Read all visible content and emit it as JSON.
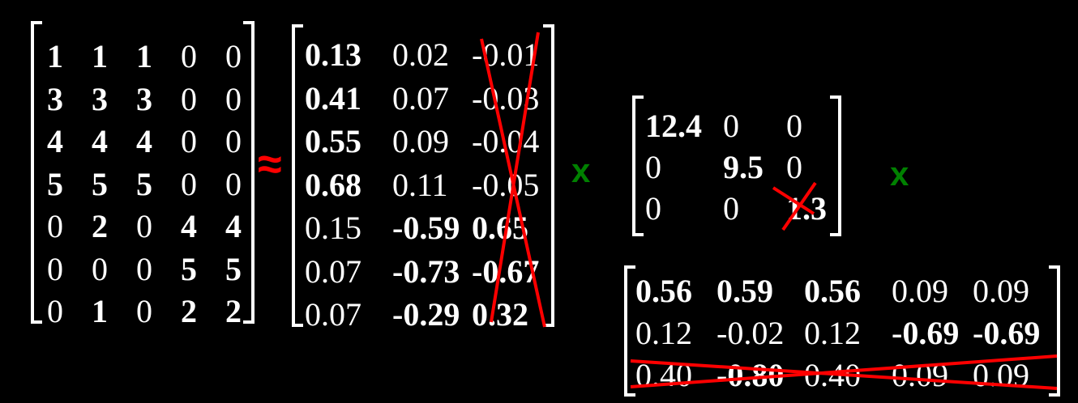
{
  "colors": {
    "background": "#000000",
    "text": "#ffffff",
    "approx": "#ff0000",
    "times": "#008000",
    "strike": "#ff0000"
  },
  "operators": {
    "approx": "≈",
    "times1": "x",
    "times2": "x"
  },
  "matrices": {
    "A": {
      "rows": [
        [
          {
            "v": "1",
            "b": true
          },
          {
            "v": "1",
            "b": true
          },
          {
            "v": "1",
            "b": true
          },
          {
            "v": "0",
            "b": false
          },
          {
            "v": "0",
            "b": false
          }
        ],
        [
          {
            "v": "3",
            "b": true
          },
          {
            "v": "3",
            "b": true
          },
          {
            "v": "3",
            "b": true
          },
          {
            "v": "0",
            "b": false
          },
          {
            "v": "0",
            "b": false
          }
        ],
        [
          {
            "v": "4",
            "b": true
          },
          {
            "v": "4",
            "b": true
          },
          {
            "v": "4",
            "b": true
          },
          {
            "v": "0",
            "b": false
          },
          {
            "v": "0",
            "b": false
          }
        ],
        [
          {
            "v": "5",
            "b": true
          },
          {
            "v": "5",
            "b": true
          },
          {
            "v": "5",
            "b": true
          },
          {
            "v": "0",
            "b": false
          },
          {
            "v": "0",
            "b": false
          }
        ],
        [
          {
            "v": "0",
            "b": false
          },
          {
            "v": "2",
            "b": true
          },
          {
            "v": "0",
            "b": false
          },
          {
            "v": "4",
            "b": true
          },
          {
            "v": "4",
            "b": true
          }
        ],
        [
          {
            "v": "0",
            "b": false
          },
          {
            "v": "0",
            "b": false
          },
          {
            "v": "0",
            "b": false
          },
          {
            "v": "5",
            "b": true
          },
          {
            "v": "5",
            "b": true
          }
        ],
        [
          {
            "v": "0",
            "b": false
          },
          {
            "v": "1",
            "b": true
          },
          {
            "v": "0",
            "b": false
          },
          {
            "v": "2",
            "b": true
          },
          {
            "v": "2",
            "b": true
          }
        ]
      ]
    },
    "U": {
      "rows": [
        [
          {
            "v": "0.13",
            "b": true
          },
          {
            "v": "0.02",
            "b": false
          },
          {
            "v": "-0.01",
            "b": false
          }
        ],
        [
          {
            "v": "0.41",
            "b": true
          },
          {
            "v": "0.07",
            "b": false
          },
          {
            "v": "-0.03",
            "b": false
          }
        ],
        [
          {
            "v": "0.55",
            "b": true
          },
          {
            "v": "0.09",
            "b": false
          },
          {
            "v": "-0.04",
            "b": false
          }
        ],
        [
          {
            "v": "0.68",
            "b": true
          },
          {
            "v": "0.11",
            "b": false
          },
          {
            "v": "-0.05",
            "b": false
          }
        ],
        [
          {
            "v": "0.15",
            "b": false
          },
          {
            "v": "-0.59",
            "b": true
          },
          {
            "v": "0.65",
            "b": true
          }
        ],
        [
          {
            "v": "0.07",
            "b": false
          },
          {
            "v": "-0.73",
            "b": true
          },
          {
            "v": "-0.67",
            "b": true
          }
        ],
        [
          {
            "v": "0.07",
            "b": false
          },
          {
            "v": "-0.29",
            "b": true
          },
          {
            "v": "0.32",
            "b": true
          }
        ]
      ]
    },
    "S": {
      "rows": [
        [
          {
            "v": "12.4",
            "b": true
          },
          {
            "v": "0",
            "b": false
          },
          {
            "v": "0",
            "b": false
          }
        ],
        [
          {
            "v": "0",
            "b": false
          },
          {
            "v": "9.5",
            "b": true
          },
          {
            "v": "0",
            "b": false
          }
        ],
        [
          {
            "v": "0",
            "b": false
          },
          {
            "v": "0",
            "b": false
          },
          {
            "v": "1.3",
            "b": true
          }
        ]
      ]
    },
    "V": {
      "rows": [
        [
          {
            "v": "0.56",
            "b": true
          },
          {
            "v": "0.59",
            "b": true
          },
          {
            "v": "0.56",
            "b": true
          },
          {
            "v": "0.09",
            "b": false
          },
          {
            "v": "0.09",
            "b": false
          }
        ],
        [
          {
            "v": "0.12",
            "b": false
          },
          {
            "v": "-0.02",
            "b": false
          },
          {
            "v": "0.12",
            "b": false
          },
          {
            "v": "-0.69",
            "b": true
          },
          {
            "v": "-0.69",
            "b": true
          }
        ],
        [
          {
            "v": "0.40",
            "b": false
          },
          {
            "v": "-0.80",
            "b": true
          },
          {
            "v": "0.40",
            "b": false
          },
          {
            "v": "0.09",
            "b": false
          },
          {
            "v": "0.09",
            "b": false
          }
        ]
      ]
    }
  }
}
